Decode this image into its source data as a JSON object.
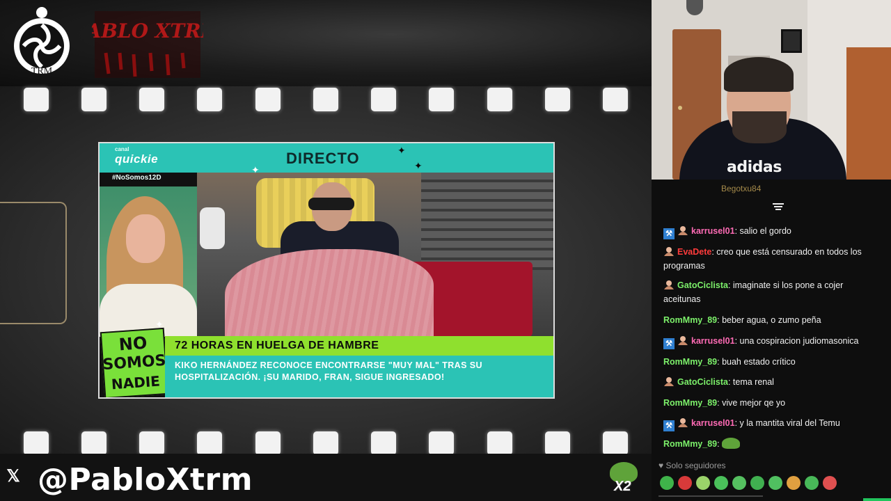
{
  "overlay": {
    "logo_trm_text": "TRM",
    "logo_pablo_text": "PABLO XTRM",
    "social_handle": "@PabloXtrm",
    "social_icon": "x-logo-icon",
    "badge_text": "X2"
  },
  "tv": {
    "channel_small": "canal",
    "channel_name": "quickie",
    "hashtag": "#NoSomos12D",
    "status": "DIRECTO",
    "show_logo": [
      "NO",
      "SOMOS",
      "NADIE"
    ],
    "headline": "72 HORAS EN HUELGA DE HAMBRE",
    "subline": "KIKO HERNÁNDEZ RECONOCE ENCONTRARSE \"MUY MAL\" TRAS SU HOSPITALIZACIÓN. ¡SU MARIDO, FRAN, SIGUE INGRESADO!"
  },
  "webcam": {
    "hoodie_text": "adidas"
  },
  "chat": {
    "pinned_cut": "Begotxu84",
    "messages": [
      {
        "user": "karrusel01",
        "color": "#ff6bb5",
        "mod": true,
        "sub": true,
        "text": "salio el gordo"
      },
      {
        "user": "EvaDete",
        "color": "#ff3b3b",
        "mod": false,
        "sub": true,
        "text": "creo que está censurado en todos los programas"
      },
      {
        "user": "GatoCiclista",
        "color": "#7cf06a",
        "mod": false,
        "sub": true,
        "text": "imaginate si los pone a cojer aceitunas"
      },
      {
        "user": "RomMmy_89",
        "color": "#7cf06a",
        "mod": false,
        "sub": false,
        "text": "beber agua, o zumo peña"
      },
      {
        "user": "karrusel01",
        "color": "#ff6bb5",
        "mod": true,
        "sub": true,
        "text": "una cospiracion judiomasonica"
      },
      {
        "user": "RomMmy_89",
        "color": "#7cf06a",
        "mod": false,
        "sub": false,
        "text": "buah estado crítico"
      },
      {
        "user": "GatoCiclista",
        "color": "#7cf06a",
        "mod": false,
        "sub": true,
        "text": "tema renal"
      },
      {
        "user": "RomMmy_89",
        "color": "#7cf06a",
        "mod": false,
        "sub": false,
        "text": "vive mejor qe yo"
      },
      {
        "user": "karrusel01",
        "color": "#ff6bb5",
        "mod": true,
        "sub": true,
        "text": "y la mantita viral del Temu"
      },
      {
        "user": "RomMmy_89",
        "color": "#7cf06a",
        "mod": false,
        "sub": false,
        "text": ""
      }
    ],
    "followers_mode": "Solo seguidores",
    "emote_colors": [
      "#3fb34a",
      "#d83a3a",
      "#9bd36a",
      "#4ac05a",
      "#55c060",
      "#40b050",
      "#50c060",
      "#e0a040",
      "#48b858",
      "#e05050"
    ]
  }
}
